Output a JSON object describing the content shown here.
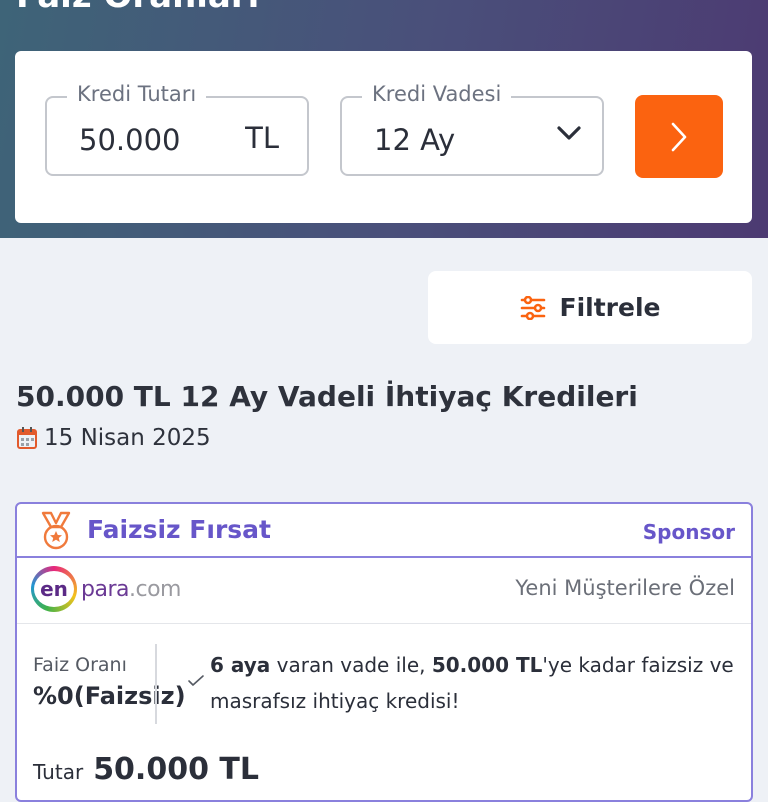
{
  "hero": {
    "title": "Faiz Oranları"
  },
  "search": {
    "amount": {
      "legend": "Kredi Tutarı",
      "value": "50.000",
      "unit": "TL"
    },
    "term": {
      "legend": "Kredi Vadesi",
      "value": "12 Ay"
    },
    "submit_icon": "chevron-right-icon"
  },
  "filter": {
    "label": "Filtrele",
    "icon": "sliders-icon"
  },
  "results": {
    "heading": "50.000 TL 12 Ay Vadeli İhtiyaç Kredileri",
    "date": "15 Nisan 2025"
  },
  "offer": {
    "tag": "Faizsiz Fırsat",
    "sponsor": "Sponsor",
    "bank": {
      "logo_badge": "en",
      "logo_word": "para",
      "logo_domain": ".com"
    },
    "note": "Yeni Müşterilere Özel",
    "rate_label": "Faiz Oranı",
    "rate_value": "%0(Faizsiz)",
    "description": {
      "months": "6 aya",
      "text1": " varan vade ile, ",
      "amount": "50.000 TL",
      "text2": "'ye kadar faizsiz ve masrafsız ihtiyaç kredisi!"
    },
    "total_label": "Tutar",
    "total_value": "50.000 TL"
  },
  "colors": {
    "accent_orange": "#fb6310",
    "accent_purple": "#6756c9",
    "hero_gradient_start": "#3e6478",
    "hero_gradient_end": "#4c3a72"
  }
}
